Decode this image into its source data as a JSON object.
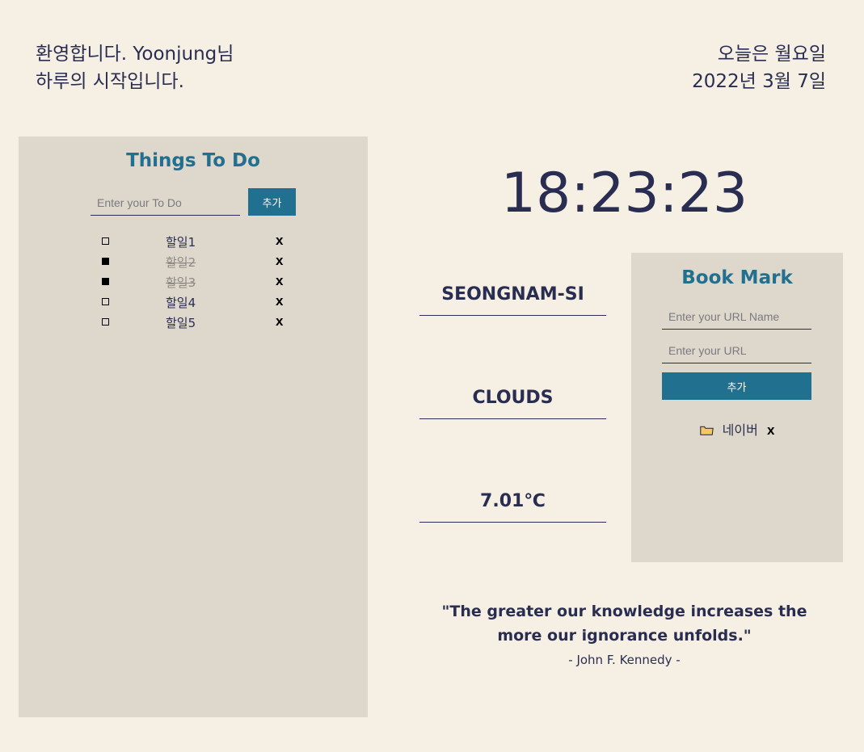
{
  "greeting": {
    "line1": "환영합니다. Yoonjung님",
    "line2": "하루의 시작입니다."
  },
  "date": {
    "line1": "오늘은 월요일",
    "line2": "2022년 3월 7일"
  },
  "todo": {
    "title": "Things To Do",
    "input_placeholder": "Enter your To Do",
    "add_label": "추가",
    "delete_label": "x",
    "items": [
      {
        "label": "할일1",
        "done": false
      },
      {
        "label": "할일2",
        "done": true
      },
      {
        "label": "할일3",
        "done": true
      },
      {
        "label": "할일4",
        "done": false
      },
      {
        "label": "할일5",
        "done": false
      }
    ]
  },
  "clock": {
    "time": "18:23:23"
  },
  "weather": {
    "city": "SEONGNAM-SI",
    "condition": "CLOUDS",
    "temperature": "7.01℃"
  },
  "bookmark": {
    "title": "Book Mark",
    "name_placeholder": "Enter your URL Name",
    "url_placeholder": "Enter your URL",
    "add_label": "추가",
    "delete_label": "x",
    "items": [
      {
        "label": "네이버",
        "icon": "folder-icon"
      }
    ]
  },
  "quote": {
    "text": "\"The greater our knowledge increases the more our ignorance unfolds.\"",
    "author": "- John F. Kennedy -"
  },
  "colors": {
    "background": "#f6f0e4",
    "panel": "#ded7cb",
    "accent": "#21708f",
    "text": "#2a2d52"
  }
}
